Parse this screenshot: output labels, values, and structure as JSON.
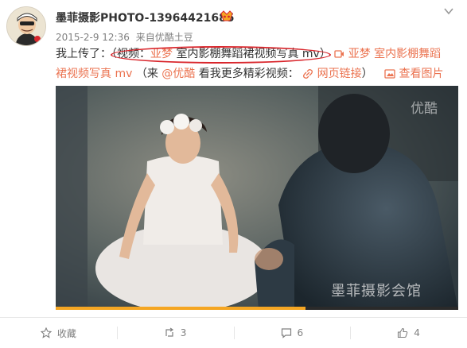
{
  "post": {
    "username": "墨菲摄影PHOTO-13964421685",
    "date": "2015-2-9 12:36",
    "source_prefix": "来自",
    "source": "优酷土豆",
    "text_prefix": "我上传了：",
    "paren_open": "（",
    "video_label": "视频：",
    "video_title_highlight": "亚梦",
    "video_title_rest": " 室内影棚舞蹈裙视频写真 mv",
    "paren_close": "）",
    "link_title_line1": "亚梦 室内影棚舞蹈",
    "link_title_line2": "裙视频写真 mv",
    "from_open": "（来 ",
    "from_mention": "@优酷",
    "from_rest": " 看我更多精彩视频：",
    "web_link_label": "网页链接",
    "close_paren2": "）",
    "view_image_label": "查看图片"
  },
  "video": {
    "watermark_top": "优酷",
    "watermark_bottom": "墨菲摄影会馆",
    "progress": 0.62
  },
  "actions": {
    "favorite_label": "收藏",
    "repost_count": "3",
    "comment_count": "6",
    "like_count": "4"
  },
  "colors": {
    "accent": "#eb7350",
    "highlight_oval": "#d9262c",
    "progress": "#f5a623"
  },
  "icons": [
    "avatar",
    "vip-icon",
    "chevron-down-icon",
    "video-icon",
    "link-icon",
    "image-icon",
    "star-icon",
    "repost-icon",
    "comment-icon",
    "like-icon"
  ]
}
